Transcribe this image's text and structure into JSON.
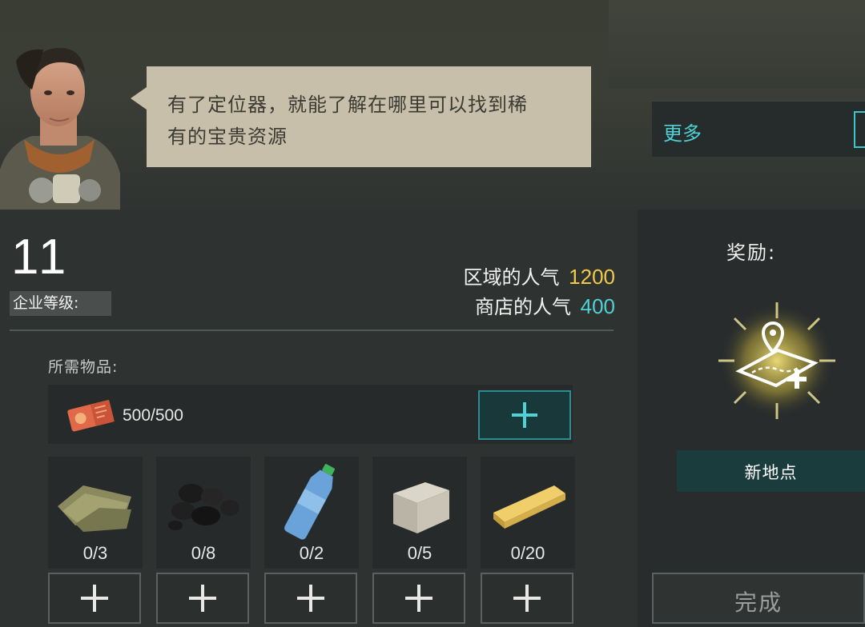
{
  "npc": {
    "dialogue_line1": "有了定位器，就能了解在哪里可以找到稀",
    "dialogue_line2": "有的宝贵资源"
  },
  "more": {
    "label": "更多"
  },
  "company": {
    "level": "11",
    "level_label": "企业等级:"
  },
  "popularity": {
    "area_label": "区域的人气",
    "area_value": "1200",
    "area_color": "#f1c94a",
    "shop_label": "商店的人气",
    "shop_value": "400",
    "shop_color": "#4fd1d5"
  },
  "required": {
    "label": "所需物品:",
    "currency": {
      "icon": "ticket-icon",
      "count": "500/500"
    },
    "items": [
      {
        "icon": "cloth-icon",
        "count": "0/3"
      },
      {
        "icon": "coal-icon",
        "count": "0/8"
      },
      {
        "icon": "water-bottle-icon",
        "count": "0/2"
      },
      {
        "icon": "stone-block-icon",
        "count": "0/5"
      },
      {
        "icon": "wood-plank-icon",
        "count": "0/20"
      }
    ]
  },
  "reward": {
    "label": "奖励:",
    "icon": "map-location-plus-icon",
    "name": "新地点"
  },
  "complete_button": {
    "label": "完成"
  },
  "colors": {
    "accent": "#4fd1d5",
    "gold": "#f1c94a",
    "bubble": "#c7bfa9"
  }
}
